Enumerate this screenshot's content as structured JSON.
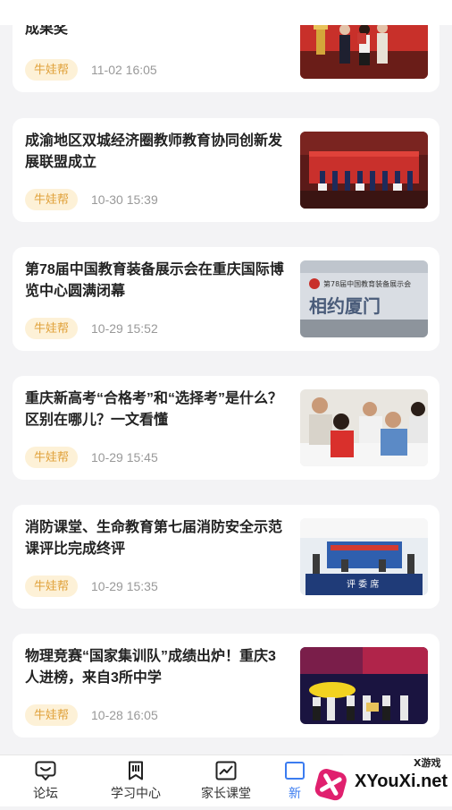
{
  "articles": [
    {
      "title": "成果奖",
      "tag": "牛娃帮",
      "time": "11-02 16:05"
    },
    {
      "title": "成渝地区双城经济圈教师教育协同创新发展联盟成立",
      "tag": "牛娃帮",
      "time": "10-30 15:39"
    },
    {
      "title": "第78届中国教育装备展示会在重庆国际博览中心圆满闭幕",
      "tag": "牛娃帮",
      "time": "10-29 15:52"
    },
    {
      "title": "重庆新高考“合格考”和“选择考”是什么？区别在哪儿？一文看懂",
      "tag": "牛娃帮",
      "time": "10-29 15:45"
    },
    {
      "title": "消防课堂、生命教育第七届消防安全示范课评比完成终评",
      "tag": "牛娃帮",
      "time": "10-29 15:35"
    },
    {
      "title": "物理竞赛“国家集训队”成绩出炉！重庆3人进榜，来自3所中学",
      "tag": "牛娃帮",
      "time": "10-28 16:05"
    }
  ],
  "photo_text": {
    "expo_banner": "第78届中国教育装备展示会",
    "expo_slogan": "相约厦门",
    "judges_sign": "评 委 席"
  },
  "tabs": [
    {
      "label": "论坛",
      "icon": "chat-bubble-icon"
    },
    {
      "label": "学习中心",
      "icon": "bookmark-icon"
    },
    {
      "label": "家长课堂",
      "icon": "chart-icon"
    },
    {
      "label": "新",
      "icon": "news-icon"
    }
  ],
  "watermark": {
    "brand": "XYouXi.net",
    "small": "X游戏"
  },
  "colors": {
    "tag_bg": "#fdf1d7",
    "tag_text": "#e0a13a",
    "accent": "#3b7cf0"
  }
}
